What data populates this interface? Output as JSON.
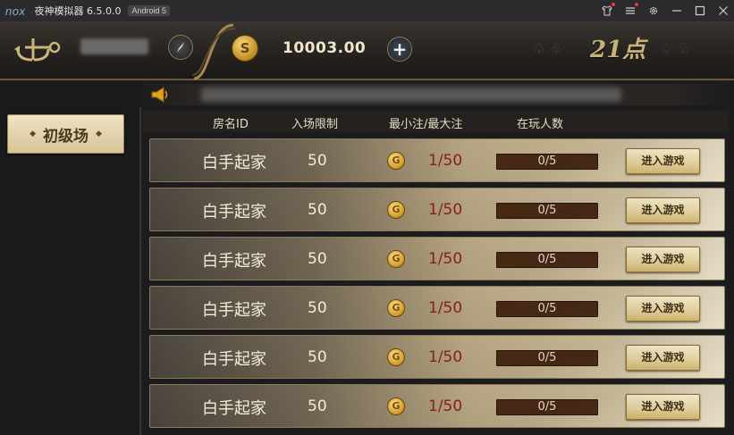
{
  "emulator": {
    "logo": "nox",
    "title": "夜神模拟器 6.5.0.0",
    "android_badge": "Android 5",
    "icons": [
      "shirt-icon",
      "menu-icon",
      "gear-icon",
      "minimize-icon",
      "maximize-icon",
      "close-icon"
    ]
  },
  "header": {
    "balance": "10003.00",
    "add_symbol": "+",
    "coin_symbol": "S",
    "game_name": "21点",
    "suits_left": "♤ ♧",
    "suits_right": "♤ ♧"
  },
  "sidebar": {
    "level_tab": "初级场",
    "diamond": "◆"
  },
  "table": {
    "columns": [
      "房名ID",
      "入场限制",
      "最小注/最大注",
      "在玩人数"
    ],
    "coin_symbol": "G",
    "rows": [
      {
        "name": "白手起家",
        "limit": "50",
        "bet": "1/50",
        "players": "0/5",
        "action": "进入游戏"
      },
      {
        "name": "白手起家",
        "limit": "50",
        "bet": "1/50",
        "players": "0/5",
        "action": "进入游戏"
      },
      {
        "name": "白手起家",
        "limit": "50",
        "bet": "1/50",
        "players": "0/5",
        "action": "进入游戏"
      },
      {
        "name": "白手起家",
        "limit": "50",
        "bet": "1/50",
        "players": "0/5",
        "action": "进入游戏"
      },
      {
        "name": "白手起家",
        "limit": "50",
        "bet": "1/50",
        "players": "0/5",
        "action": "进入游戏"
      },
      {
        "name": "白手起家",
        "limit": "50",
        "bet": "1/50",
        "players": "0/5",
        "action": "进入游戏"
      }
    ]
  },
  "colors": {
    "accent_gold": "#c9b27a",
    "bet_red": "#8a1f1a",
    "player_bar": "#4a2a16"
  }
}
